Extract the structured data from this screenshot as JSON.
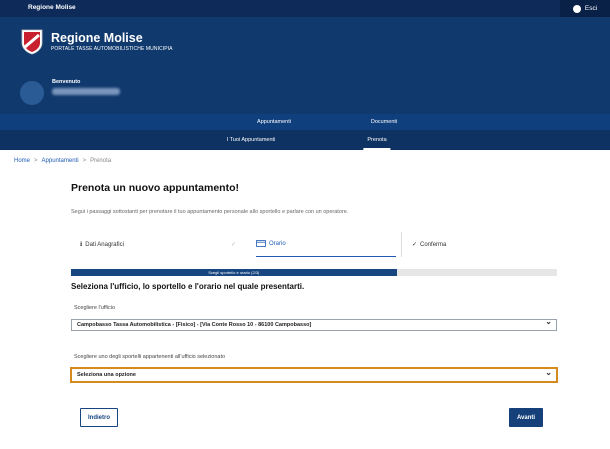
{
  "slimbar": {
    "title": "Regione Molise",
    "exit_label": "Esci"
  },
  "header": {
    "site_title": "Regione Molise",
    "site_subtitle": "PORTALE TASSE AUTOMOBILISTICHE MUNICIPIA",
    "welcome": "Benvenuto"
  },
  "nav": {
    "primary": [
      "Appuntamenti",
      "Documenti"
    ],
    "secondary": [
      "I Tuoi Appuntamenti",
      "Prenota"
    ]
  },
  "breadcrumb": [
    "Home",
    "Appuntamenti",
    "Prenota"
  ],
  "page": {
    "title": "Prenota un nuovo appuntamento!",
    "intro": "Segui i passaggi sottostanti per prenotare il tuo appuntamento personale allo sportello e parlare con un operatore."
  },
  "steps": [
    {
      "label": "Dati Anagrafici",
      "icon": "info-icon",
      "state": "done"
    },
    {
      "label": "Orario",
      "icon": "calendar-icon",
      "state": "active"
    },
    {
      "label": "Conferma",
      "icon": "check-icon",
      "state": "pending"
    }
  ],
  "progress": {
    "label": "Scegli sportello e orario (2/3)",
    "value_fraction": 0.67
  },
  "form": {
    "section_title": "Seleziona l'ufficio, lo sportello e l'orario nel quale presentarti.",
    "office_label": "Scegliere l'ufficio",
    "office_value": "Campobasso Tassa Automobilistica - [Fisico] - [Via Conte Rosso 10 - 86100 Campobasso]",
    "sportello_label": "Scegliere uno degli sportelli appartenenti all'ufficio selezionato",
    "sportello_value": "Seleziona una opzione"
  },
  "buttons": {
    "back": "Indietro",
    "next": "Avanti"
  },
  "colors": {
    "header": "#10396e",
    "slimbar": "#0d2a59",
    "primary": "#15407a",
    "focus": "#d48a1d"
  }
}
